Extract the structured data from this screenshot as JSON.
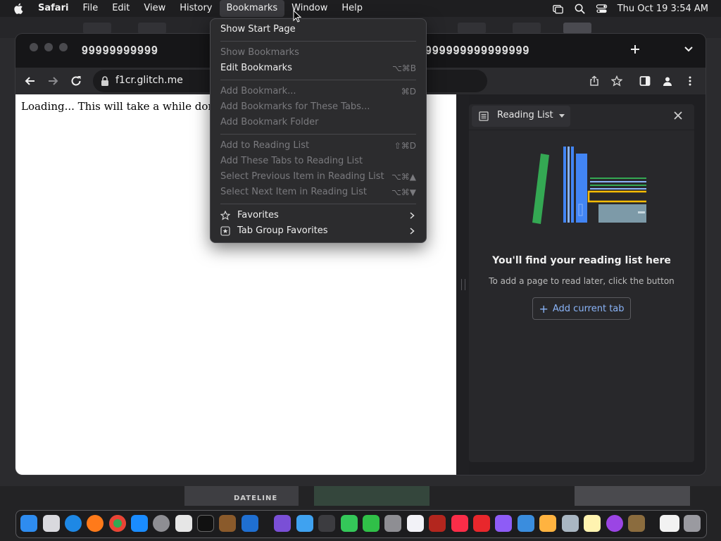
{
  "menubar": {
    "app": "Safari",
    "menus": [
      "File",
      "Edit",
      "View",
      "History",
      "Bookmarks",
      "Window",
      "Help"
    ],
    "clock": "Thu Oct 19  3:54 AM"
  },
  "chrome": {
    "tab_title_left": "𝟗𝟗𝟗𝟗𝟗𝟗𝟗𝟗𝟗𝟗𝟗",
    "tab_title_right": "𝟗𝟗𝟗𝟗𝟗𝟗𝟗𝟗𝟗𝟗𝟗𝟗𝟗𝟗𝟗",
    "url": "f1cr.glitch.me",
    "page_text": "Loading... This will take a while don't refr"
  },
  "reading_list": {
    "selector_label": "Reading List",
    "empty_title": "You'll find your reading list here",
    "empty_desc": "To add a page to read later, click the button",
    "add_button": "Add current tab"
  },
  "bookmarks_menu": {
    "items": [
      {
        "label": "Show Start Page",
        "shortcut": "",
        "disabled": false
      },
      {
        "label": "Show Bookmarks",
        "shortcut": "",
        "disabled": true
      },
      {
        "label": "Edit Bookmarks",
        "shortcut": "⌥⌘B",
        "disabled": false
      },
      {
        "label": "Add Bookmark...",
        "shortcut": "⌘D",
        "disabled": true
      },
      {
        "label": "Add Bookmarks for These Tabs...",
        "shortcut": "",
        "disabled": true
      },
      {
        "label": "Add Bookmark Folder",
        "shortcut": "",
        "disabled": true
      },
      {
        "label": "Add to Reading List",
        "shortcut": "⇧⌘D",
        "disabled": true
      },
      {
        "label": "Add These Tabs to Reading List",
        "shortcut": "",
        "disabled": true
      },
      {
        "label": "Select Previous Item in Reading List",
        "shortcut": "⌥⌘▲",
        "disabled": true
      },
      {
        "label": "Select Next Item in Reading List",
        "shortcut": "⌥⌘▼",
        "disabled": true
      },
      {
        "label": "Favorites",
        "shortcut": "",
        "disabled": false
      },
      {
        "label": "Tab Group Favorites",
        "shortcut": "",
        "disabled": false
      }
    ]
  },
  "dock": {
    "thumb_caption": "DATELINE"
  },
  "colors": {
    "accent_blue": "#8ab4f8",
    "menu_bg": "#2c2c2e",
    "disabled_text": "#7a7a7e"
  }
}
